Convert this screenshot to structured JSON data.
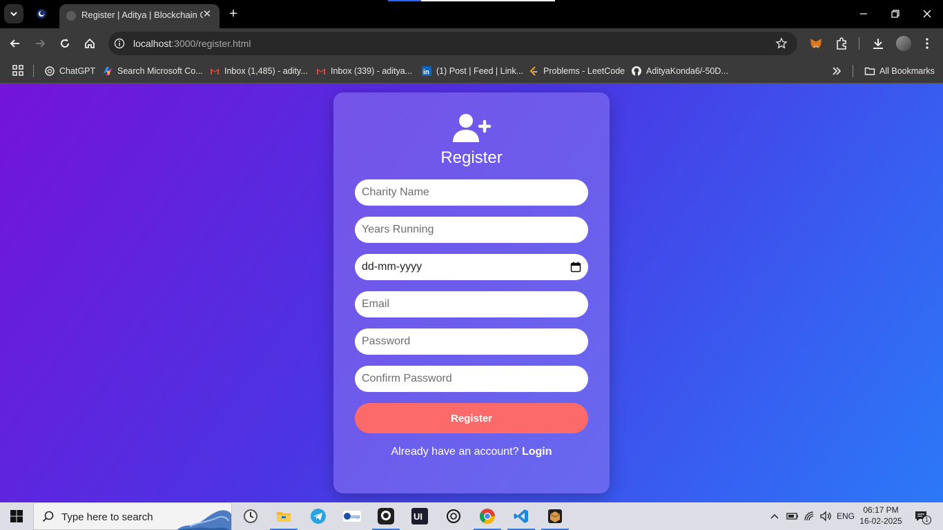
{
  "browser": {
    "tab_title": "Register | Aditya | Blockchain Ch",
    "url_host": "localhost",
    "url_path": ":3000/register.html",
    "bookmarks": [
      {
        "label": "ChatGPT",
        "icon": "openai-icon"
      },
      {
        "label": "Search Microsoft Co...",
        "icon": "copilot-icon"
      },
      {
        "label": "Inbox (1,485) - adity...",
        "icon": "gmail-icon"
      },
      {
        "label": "Inbox (339) - aditya...",
        "icon": "gmail-icon"
      },
      {
        "label": "(1) Post | Feed | Link...",
        "icon": "linkedin-icon"
      },
      {
        "label": "Problems - LeetCode",
        "icon": "leetcode-icon"
      },
      {
        "label": "AdityaKonda6/-50D...",
        "icon": "github-icon"
      }
    ],
    "all_bookmarks": "All Bookmarks"
  },
  "form": {
    "heading": "Register",
    "charity_name_placeholder": "Charity Name",
    "years_running_placeholder": "Years Running",
    "date_placeholder": "dd-mm-yyyy",
    "email_placeholder": "Email",
    "password_placeholder": "Password",
    "confirm_password_placeholder": "Confirm Password",
    "register_button": "Register",
    "login_prompt": "Already have an account?",
    "login_link": "Login"
  },
  "colors": {
    "gradient_start": "#7413d9",
    "gradient_end": "#2b79f8",
    "register_button": "#fd6a6a"
  },
  "taskbar": {
    "search_placeholder": "Type here to search",
    "language": "ENG",
    "time": "06:17 PM",
    "date": "16-02-2025",
    "notification_count": "1"
  }
}
